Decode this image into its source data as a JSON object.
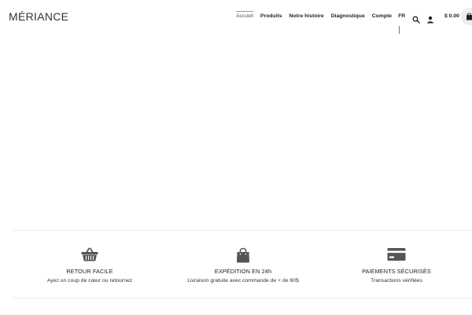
{
  "header": {
    "logo": "MÉRIANCE",
    "nav": [
      {
        "label": "Accueil",
        "active": true
      },
      {
        "label": "Produits",
        "active": false
      },
      {
        "label": "Notre histoire",
        "active": false
      },
      {
        "label": "Diagnostique",
        "active": false
      },
      {
        "label": "Compte",
        "active": false
      }
    ],
    "language": "FR",
    "cart_total": "$ 0.00",
    "icons": {
      "search": "search-icon",
      "user": "user-icon",
      "cart": "shopping-bag-icon"
    }
  },
  "features": [
    {
      "icon": "basket-icon",
      "title": "RETOUR FACILE",
      "subtitle": "Ayez un coup de cœur ou retournez"
    },
    {
      "icon": "shopping-bag-icon",
      "title": "EXPÉDITION EN 24h",
      "subtitle": "Livraison gratuite avec commande de + de 60$"
    },
    {
      "icon": "credit-card-icon",
      "title": "PAIEMENTS SÉCURISÉS",
      "subtitle": "Transactions vérifiées"
    }
  ],
  "colors": {
    "text": "#222222",
    "icon": "#555555",
    "cart_bubble": "#eeeeee",
    "rule": "#ececec"
  }
}
